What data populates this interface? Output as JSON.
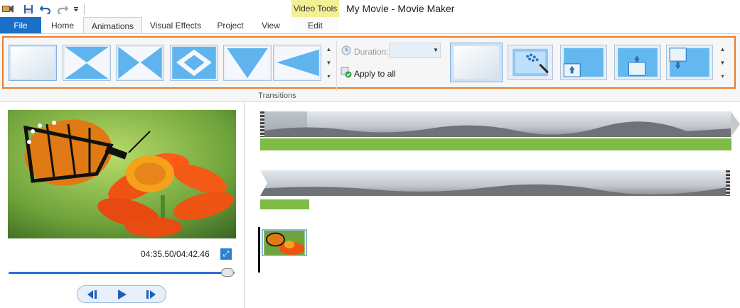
{
  "app": {
    "title": "My Movie - Movie Maker",
    "contextual_group": "Video Tools"
  },
  "quick_access": [
    {
      "icon": "app-menu-icon"
    },
    {
      "icon": "save-icon"
    },
    {
      "icon": "undo-icon"
    },
    {
      "icon": "redo-icon"
    },
    {
      "icon": "customize-dropdown-icon"
    }
  ],
  "tabs": [
    {
      "label": "File",
      "active": false
    },
    {
      "label": "Home",
      "active": false
    },
    {
      "label": "Animations",
      "active": true
    },
    {
      "label": "Visual Effects",
      "active": false
    },
    {
      "label": "Project",
      "active": false
    },
    {
      "label": "View",
      "active": false
    },
    {
      "label": "Edit",
      "active": false
    }
  ],
  "ribbon": {
    "transitions_group_label": "Transitions",
    "duration_label": "Duration:",
    "duration_value": "",
    "apply_to_all_label": "Apply to all",
    "transitions": [
      {
        "icon": "no-transition-icon",
        "selected": true
      },
      {
        "icon": "bowtie-vertical-transition-icon"
      },
      {
        "icon": "bowtie-horizontal-transition-icon"
      },
      {
        "icon": "diamond-transition-icon"
      },
      {
        "icon": "triangle-down-transition-icon"
      },
      {
        "icon": "wedge-left-transition-icon"
      }
    ],
    "pan_zoom": [
      {
        "icon": "no-pan-zoom-icon",
        "selected": true
      },
      {
        "icon": "automatic-pan-zoom-icon"
      },
      {
        "icon": "pan-up-left-icon"
      },
      {
        "icon": "pan-up-center-icon"
      },
      {
        "icon": "pan-down-icon"
      }
    ],
    "colors": {
      "accent": "#1a6fc8",
      "highlight": "#e87d2c",
      "contextual": "#f3f096"
    }
  },
  "preview": {
    "time_display": "04:35.50/04:42.46",
    "seek_fraction": 0.97,
    "controls": [
      {
        "icon": "previous-frame-icon"
      },
      {
        "icon": "play-icon"
      },
      {
        "icon": "next-frame-icon"
      }
    ]
  },
  "timeline": {
    "audio_color": "#7fbc45"
  }
}
